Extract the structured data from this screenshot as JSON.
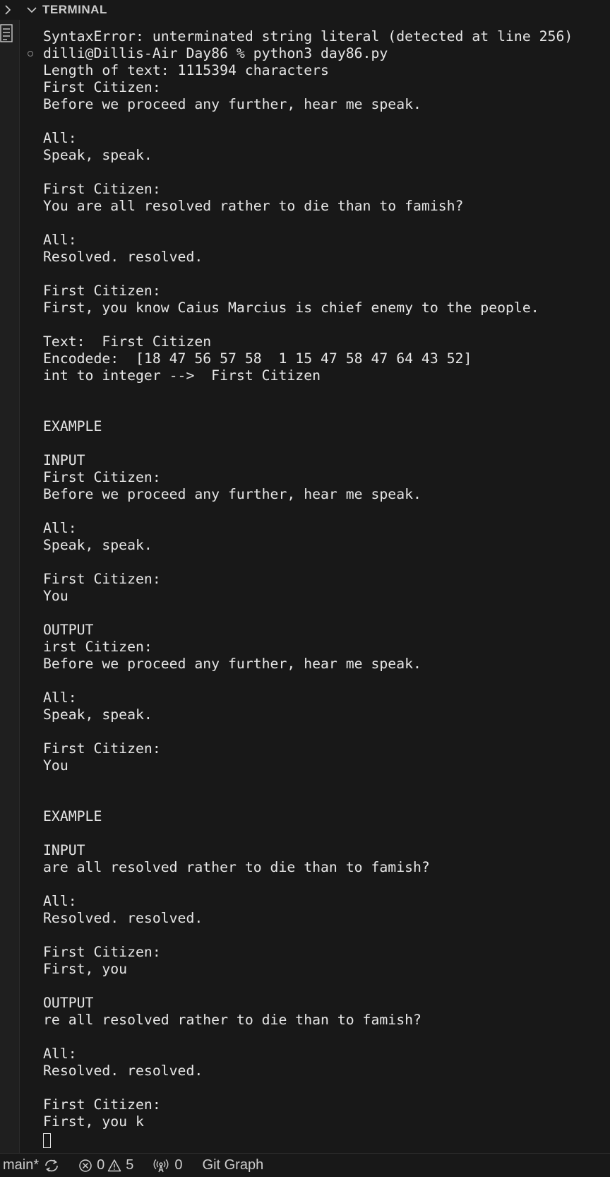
{
  "panel": {
    "title": "TERMINAL"
  },
  "terminal": {
    "output": "SyntaxError: unterminated string literal (detected at line 256)\ndilli@Dillis-Air Day86 % python3 day86.py\nLength of text: 1115394 characters\nFirst Citizen:\nBefore we proceed any further, hear me speak.\n\nAll:\nSpeak, speak.\n\nFirst Citizen:\nYou are all resolved rather to die than to famish?\n\nAll:\nResolved. resolved.\n\nFirst Citizen:\nFirst, you know Caius Marcius is chief enemy to the people.\n\nText:  First Citizen\nEncodede:  [18 47 56 57 58  1 15 47 58 47 64 43 52]\nint to integer -->  First Citizen\n\n\nEXAMPLE\n\nINPUT\nFirst Citizen:\nBefore we proceed any further, hear me speak.\n\nAll:\nSpeak, speak.\n\nFirst Citizen:\nYou\n\nOUTPUT\nirst Citizen:\nBefore we proceed any further, hear me speak.\n\nAll:\nSpeak, speak.\n\nFirst Citizen:\nYou\n\n\nEXAMPLE\n\nINPUT\nare all resolved rather to die than to famish?\n\nAll:\nResolved. resolved.\n\nFirst Citizen:\nFirst, you\n\nOUTPUT\nre all resolved rather to die than to famish?\n\nAll:\nResolved. resolved.\n\nFirst Citizen:\nFirst, you k"
  },
  "statusbar": {
    "branch": "main*",
    "errors": "0",
    "warnings": "5",
    "ports": "0",
    "git_graph": "Git Graph"
  },
  "colors": {
    "background": "#181818",
    "text": "#e6e6e6",
    "muted": "#cccccc"
  },
  "icons": {
    "panel_toggle": "chevron-right-icon",
    "panel_collapse": "chevron-down-icon",
    "list": "list-icon",
    "sync": "sync-icon",
    "error": "error-circle-icon",
    "warning": "warning-triangle-icon",
    "ports": "broadcast-icon"
  }
}
